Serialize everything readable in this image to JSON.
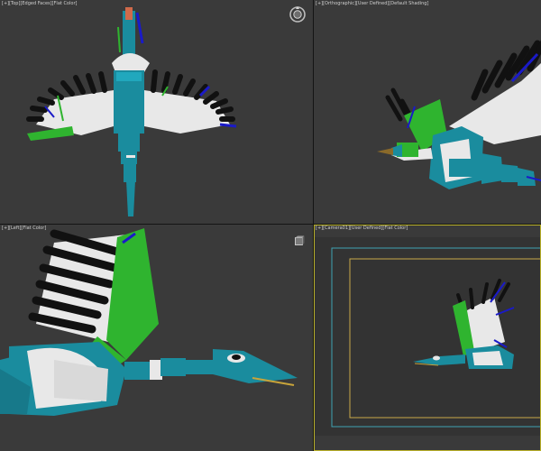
{
  "viewports": {
    "top": {
      "label_segments": [
        "[+]",
        "[Top]",
        "[Edged Faces]",
        "[Flat Color]"
      ],
      "active": false
    },
    "ortho": {
      "label_segments": [
        "[+]",
        "[Orthographic]",
        "[User Defined]",
        "[Default Shading]"
      ],
      "active": false
    },
    "left": {
      "label_segments": [
        "[+]",
        "[Left]",
        "[Flat Color]"
      ],
      "active": false
    },
    "camera": {
      "label_segments": [
        "[+]",
        "[Camera01]",
        "[User Defined]",
        "[Flat Color]"
      ],
      "active": true
    }
  },
  "icons": {
    "viewcube": "viewcube-icon",
    "nav_gizmo": "nav-gizmo-icon"
  },
  "colors": {
    "viewport_bg": "#3a3a3a",
    "bone_teal": "#1a8c9e",
    "feather_black": "#111111",
    "feather_white": "#e8e8e8",
    "bone_green": "#2fb42f",
    "bone_blue": "#1a1ac8",
    "active_border": "#b8b02a",
    "safe_frame_outer": "#3fa3b3",
    "safe_frame_inner": "#c9a94a"
  }
}
